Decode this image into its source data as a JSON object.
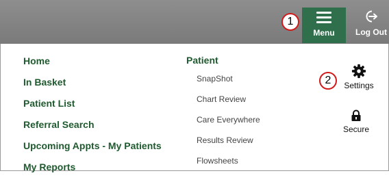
{
  "header": {
    "menu_label": "Menu",
    "logout_label": "Log Out",
    "callouts": [
      "1",
      "2"
    ]
  },
  "nav": {
    "primary": [
      "Home",
      "In Basket",
      "Patient List",
      "Referral Search",
      "Upcoming Appts - My Patients",
      "My Reports"
    ],
    "patient_heading": "Patient",
    "patient_items": [
      "SnapShot",
      "Chart Review",
      "Care Everywhere",
      "Results Review",
      "Flowsheets"
    ]
  },
  "tools": {
    "settings_label": "Settings",
    "secure_label": "Secure"
  },
  "colors": {
    "topbar": "#8a8a8a",
    "menu_button": "#2f6f4c",
    "link_green": "#1f5a2f",
    "callout_border": "#d11a1a"
  },
  "icons": [
    "hamburger-icon",
    "logout-icon",
    "gear-icon",
    "lock-icon"
  ]
}
